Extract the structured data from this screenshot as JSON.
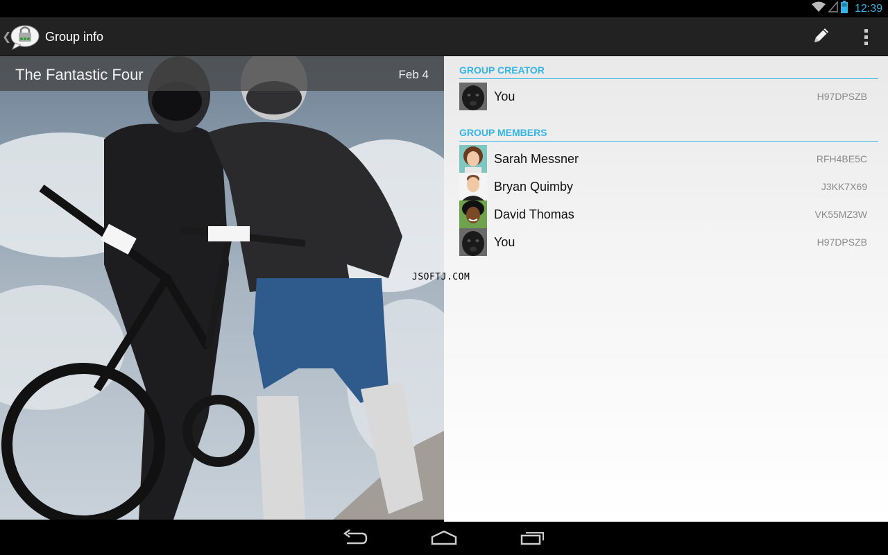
{
  "status_bar": {
    "time": "12:39",
    "icons": [
      "wifi-icon",
      "signal-icon",
      "battery-icon"
    ]
  },
  "action_bar": {
    "title": "Group info",
    "app_icon": "chat-lock-icon",
    "actions": [
      "edit-icon",
      "overflow-menu-icon"
    ]
  },
  "group": {
    "name": "The Fantastic Four",
    "date": "Feb 4"
  },
  "creator_section": {
    "header": "GROUP CREATOR",
    "members": [
      {
        "name": "You",
        "id": "H97DPSZB",
        "avatar": "dog-avatar"
      }
    ]
  },
  "members_section": {
    "header": "GROUP MEMBERS",
    "members": [
      {
        "name": "Sarah Messner",
        "id": "RFH4BE5C",
        "avatar": "woman-avatar"
      },
      {
        "name": "Bryan Quimby",
        "id": "J3KK7X69",
        "avatar": "man-avatar"
      },
      {
        "name": "David Thomas",
        "id": "VK55MZ3W",
        "avatar": "man-dark-avatar"
      },
      {
        "name": "You",
        "id": "H97DPSZB",
        "avatar": "dog-avatar"
      }
    ]
  },
  "watermark": "JSOFTJ.COM",
  "colors": {
    "accent": "#33b5e5",
    "action_bar": "#222222"
  },
  "nav_bar": {
    "buttons": [
      "back-icon",
      "home-icon",
      "recent-apps-icon"
    ]
  }
}
